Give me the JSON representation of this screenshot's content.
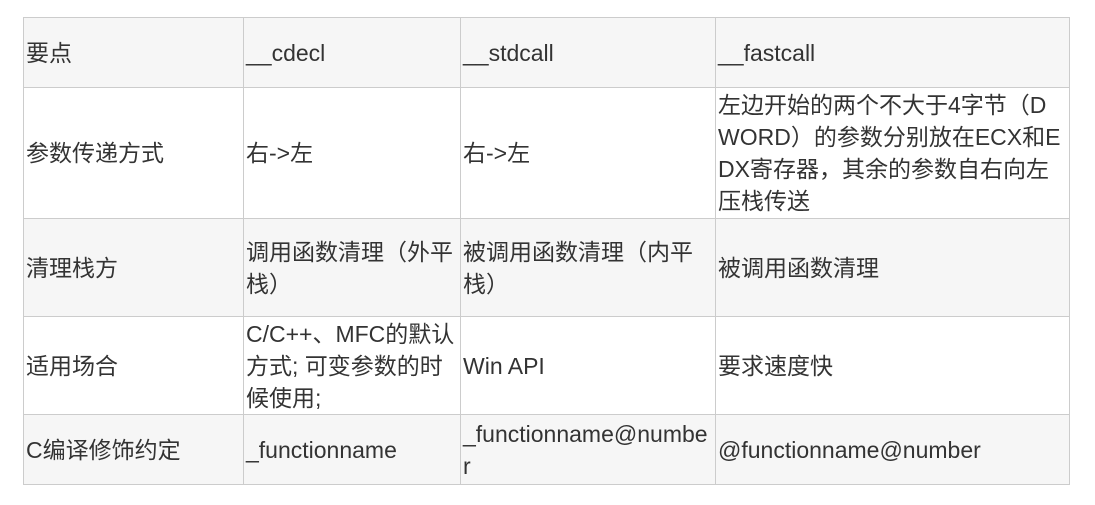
{
  "table": {
    "rows": [
      [
        "要点",
        "__cdecl",
        "__stdcall",
        "__fastcall"
      ],
      [
        "参数传递方式",
        "右->左",
        "右->左",
        "左边开始的两个不大于4字节（DWORD）的参数分别放在ECX和EDX寄存器，其余的参数自右向左压栈传送"
      ],
      [
        "清理栈方",
        "调用函数清理（外平栈）",
        "被调用函数清理（内平栈）",
        "被调用函数清理"
      ],
      [
        "适用场合",
        "C/C++、MFC的默认方式; 可变参数的时候使用;",
        "Win API",
        "要求速度快"
      ],
      [
        "C编译修饰约定",
        "_functionname",
        "_functionname@number",
        "@functionname@number"
      ]
    ]
  }
}
